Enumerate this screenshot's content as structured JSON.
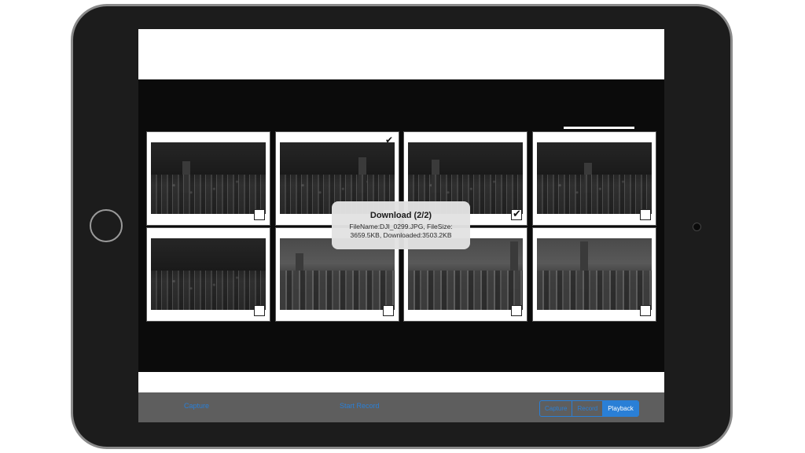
{
  "dialog": {
    "title": "Download (2/2)",
    "message_line1": "FileName:DJI_0299.JPG, FileSize:",
    "message_line2": "3659.5KB, Downloaded:3503.2KB"
  },
  "toolbar": {
    "capture_label": "Capture",
    "start_record_label": "Start Record",
    "modes": [
      {
        "label": "Capture",
        "active": false
      },
      {
        "label": "Record",
        "active": false
      },
      {
        "label": "Playback",
        "active": true
      }
    ]
  },
  "photos": [
    {
      "scene": "night",
      "selected": false
    },
    {
      "scene": "night",
      "selected": false
    },
    {
      "scene": "night",
      "selected": true
    },
    {
      "scene": "night",
      "selected": false
    },
    {
      "scene": "night",
      "selected": false
    },
    {
      "scene": "day",
      "selected": false
    },
    {
      "scene": "day",
      "selected": false
    },
    {
      "scene": "day",
      "selected": false
    }
  ],
  "icons": {
    "checkmark": "checkmark-icon",
    "download_check": "download-check-icon"
  }
}
